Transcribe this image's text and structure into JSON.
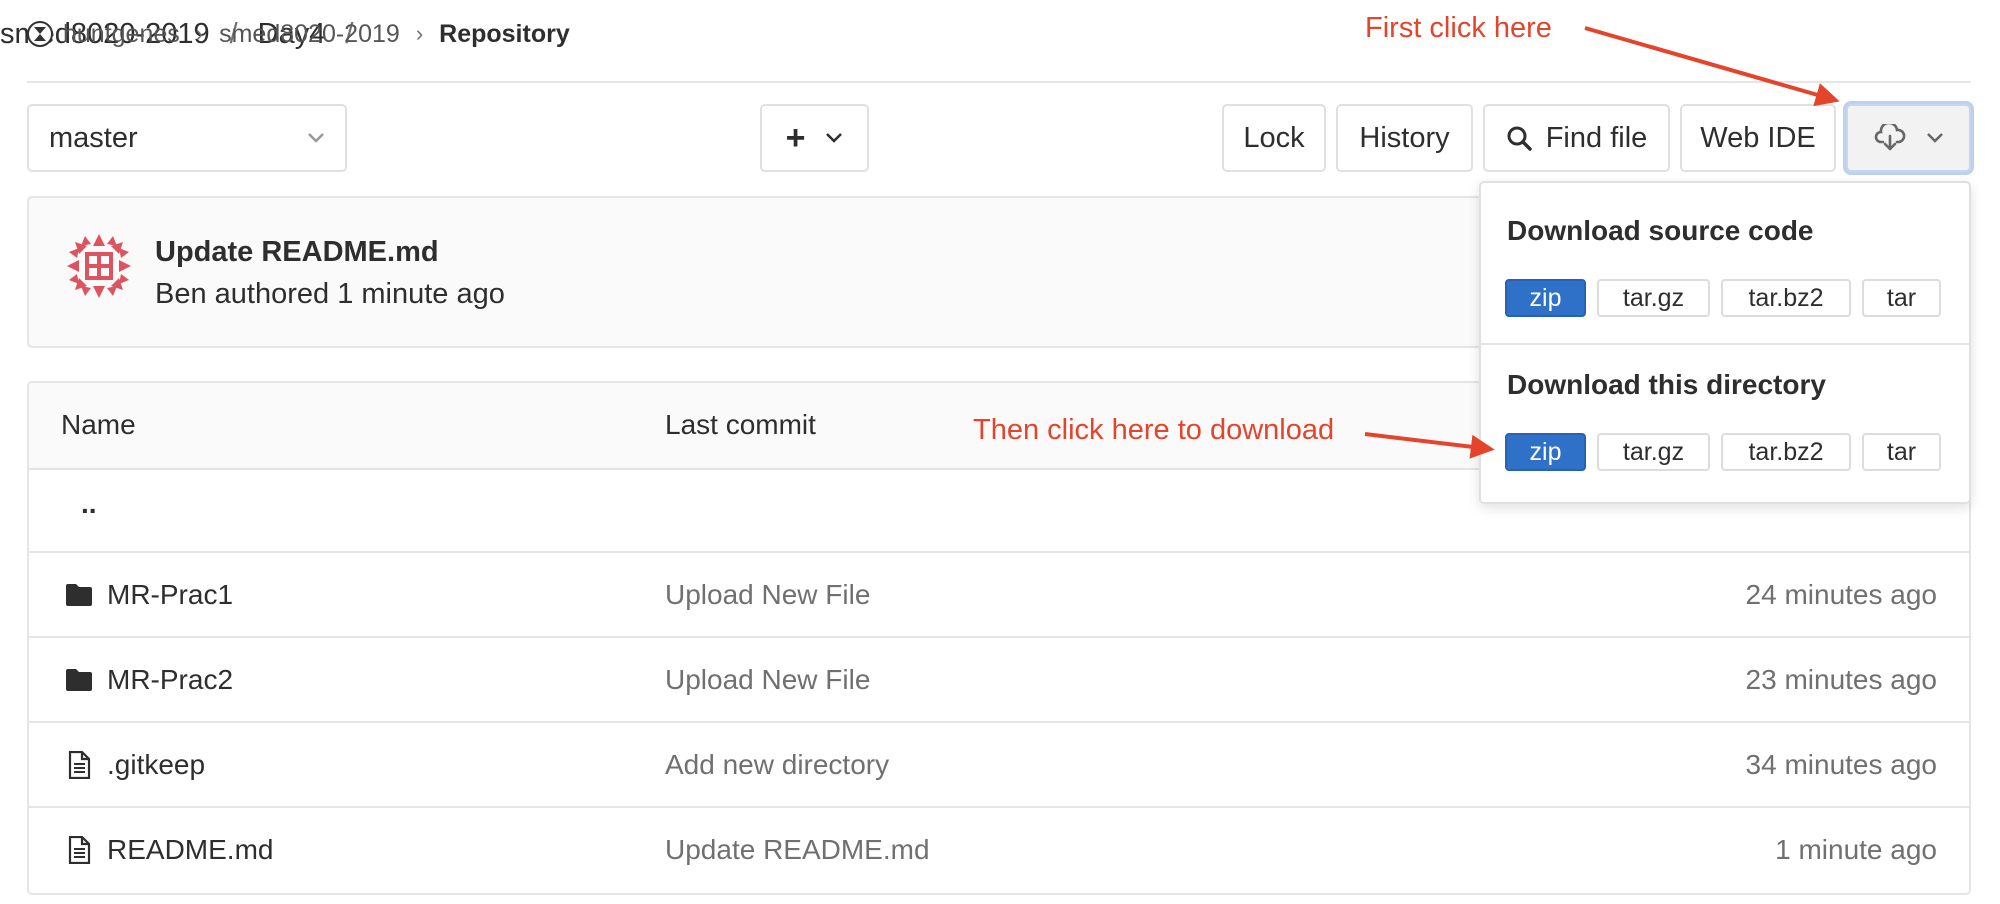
{
  "breadcrumb": {
    "group": "huntgenes",
    "project": "smed8020-2019",
    "current": "Repository"
  },
  "toolbar": {
    "branch": "master",
    "path": [
      "smed8020-2019",
      "Day4"
    ],
    "add_label": "+",
    "lock_label": "Lock",
    "history_label": "History",
    "find_file_label": "Find file",
    "web_ide_label": "Web IDE"
  },
  "last_commit": {
    "title": "Update README.md",
    "meta": "Ben authored 1 minute ago"
  },
  "table": {
    "headers": {
      "name": "Name",
      "last_commit": "Last commit"
    },
    "parent": "..",
    "rows": [
      {
        "name": "MR-Prac1",
        "icon": "folder-icon",
        "commit": "Upload New File",
        "time": "24 minutes ago"
      },
      {
        "name": "MR-Prac2",
        "icon": "folder-icon",
        "commit": "Upload New File",
        "time": "23 minutes ago"
      },
      {
        "name": ".gitkeep",
        "icon": "file-icon",
        "commit": "Add new directory",
        "time": "34 minutes ago"
      },
      {
        "name": "README.md",
        "icon": "file-icon",
        "commit": "Update README.md",
        "time": "1 minute ago"
      }
    ]
  },
  "download_menu": {
    "source_header": "Download source code",
    "directory_header": "Download this directory",
    "formats": [
      "zip",
      "tar.gz",
      "tar.bz2",
      "tar"
    ]
  },
  "annotations": {
    "first": "First click here",
    "second": "Then click here to download"
  },
  "colors": {
    "annotation": "#e4442b",
    "primary": "#2f70c9",
    "avatar": "#dd5461"
  }
}
